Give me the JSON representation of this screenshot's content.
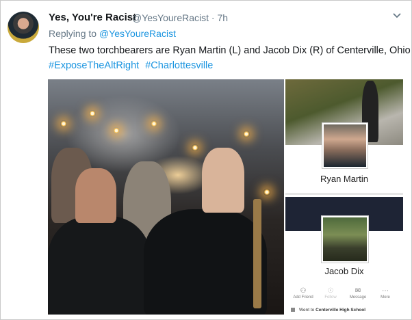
{
  "tweet": {
    "display_name": "Yes, You're Racist",
    "handle_time": "@YesYoureRacist · 7h",
    "replying_prefix": "Replying to",
    "replying_to": "@YesYoureRacist",
    "text": "These two torchbearers are Ryan Martin (L) and Jacob Dix (R) of Centerville, Ohio",
    "hashtags": [
      "#ExposeTheAltRight",
      "#Charlottesville"
    ]
  },
  "media": {
    "profile_1_name": "Ryan Martin",
    "profile_2_name": "Jacob Dix",
    "actions": [
      "Add Friend",
      "Follow",
      "Message",
      "More"
    ],
    "went_prefix": "Went to",
    "went_school": "Centerville High School"
  },
  "icons": {
    "menu_chevron": "chevron-down-icon",
    "add_friend": "add-friend-icon",
    "follow": "follow-icon",
    "message": "messenger-icon",
    "more": "more-icon",
    "education": "school-icon"
  }
}
